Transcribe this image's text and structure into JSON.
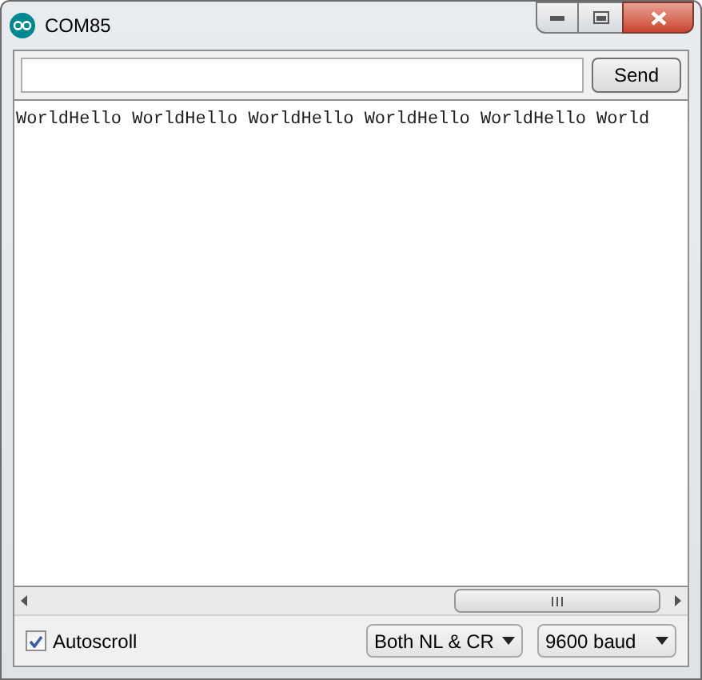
{
  "window": {
    "title": "COM85"
  },
  "send_button": "Send",
  "output": {
    "text": "WorldHello WorldHello WorldHello WorldHello WorldHello World"
  },
  "autoscroll": {
    "label": "Autoscroll",
    "checked": true
  },
  "line_ending": {
    "value": "Both NL & CR"
  },
  "baud_rate": {
    "value": "9600 baud"
  }
}
